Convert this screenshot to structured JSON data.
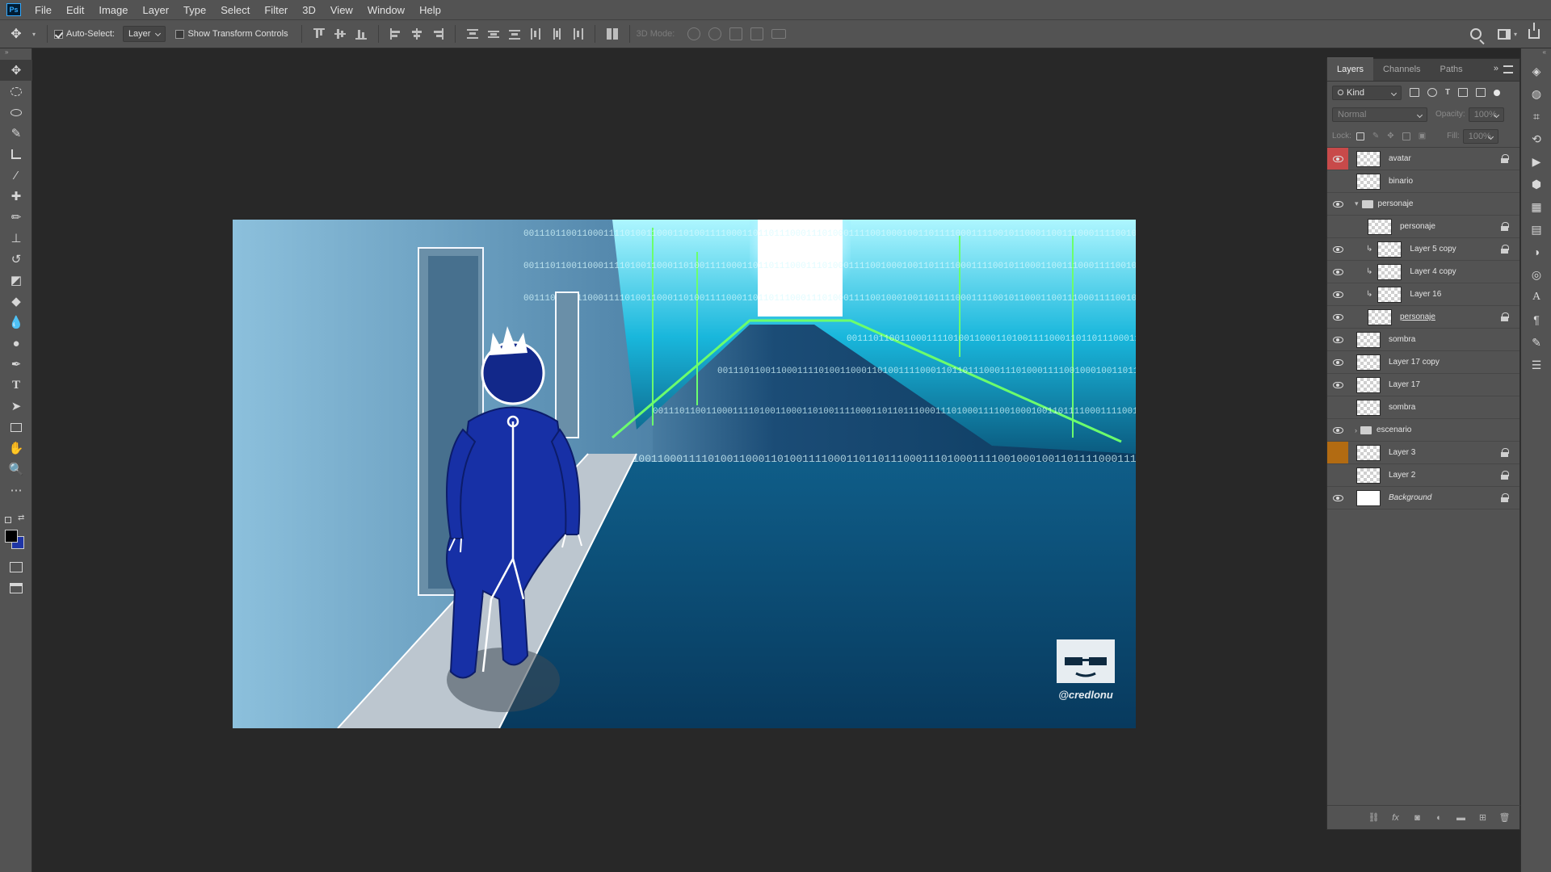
{
  "app": {
    "logo_text": "Ps"
  },
  "menu": [
    "File",
    "Edit",
    "Image",
    "Layer",
    "Type",
    "Select",
    "Filter",
    "3D",
    "View",
    "Window",
    "Help"
  ],
  "options": {
    "auto_select_label": "Auto-Select:",
    "auto_select_value": "Layer",
    "show_transform_label": "Show Transform Controls",
    "mode_3d_label": "3D Mode:"
  },
  "panel": {
    "tabs": [
      "Layers",
      "Channels",
      "Paths"
    ],
    "filter_kind": "Kind",
    "blend_mode": "Normal",
    "opacity_label": "Opacity:",
    "opacity_value": "100%",
    "lock_label": "Lock:",
    "fill_label": "Fill:",
    "fill_value": "100%"
  },
  "layers": [
    {
      "name": "avatar",
      "visible": true,
      "locked": true,
      "indent": 0,
      "type": "layer",
      "label_color": "#c84a4a"
    },
    {
      "name": "binario",
      "visible": false,
      "locked": false,
      "indent": 0,
      "type": "layer"
    },
    {
      "name": "personaje",
      "visible": true,
      "locked": false,
      "indent": 0,
      "type": "group",
      "expanded": true
    },
    {
      "name": "personaje",
      "visible": false,
      "locked": true,
      "indent": 1,
      "type": "layer"
    },
    {
      "name": "Layer 5 copy",
      "visible": true,
      "locked": true,
      "indent": 1,
      "type": "clip"
    },
    {
      "name": "Layer 4 copy",
      "visible": true,
      "locked": false,
      "indent": 1,
      "type": "clip"
    },
    {
      "name": "Layer 16",
      "visible": true,
      "locked": false,
      "indent": 1,
      "type": "clip"
    },
    {
      "name": "personaje",
      "visible": true,
      "locked": true,
      "indent": 1,
      "type": "layer",
      "underline": true
    },
    {
      "name": "sombra",
      "visible": true,
      "locked": false,
      "indent": 0,
      "type": "layer"
    },
    {
      "name": "Layer 17 copy",
      "visible": true,
      "locked": false,
      "indent": 0,
      "type": "layer"
    },
    {
      "name": "Layer 17",
      "visible": true,
      "locked": false,
      "indent": 0,
      "type": "layer"
    },
    {
      "name": "sombra",
      "visible": false,
      "locked": false,
      "indent": 0,
      "type": "layer"
    },
    {
      "name": "escenario",
      "visible": true,
      "locked": false,
      "indent": 0,
      "type": "group",
      "expanded": false
    },
    {
      "name": "Layer 3",
      "visible": false,
      "locked": true,
      "indent": 0,
      "type": "layer",
      "label_color": "#b26b12"
    },
    {
      "name": "Layer 2",
      "visible": false,
      "locked": true,
      "indent": 0,
      "type": "layer"
    },
    {
      "name": "Background",
      "visible": true,
      "locked": true,
      "indent": 0,
      "type": "background"
    }
  ],
  "canvas": {
    "watermark": "@credlonu",
    "binary_text": "0011101100110001111010011000110100111100011011011100011101000111100100010011011110001111001011000110011100011110010110100110011"
  }
}
